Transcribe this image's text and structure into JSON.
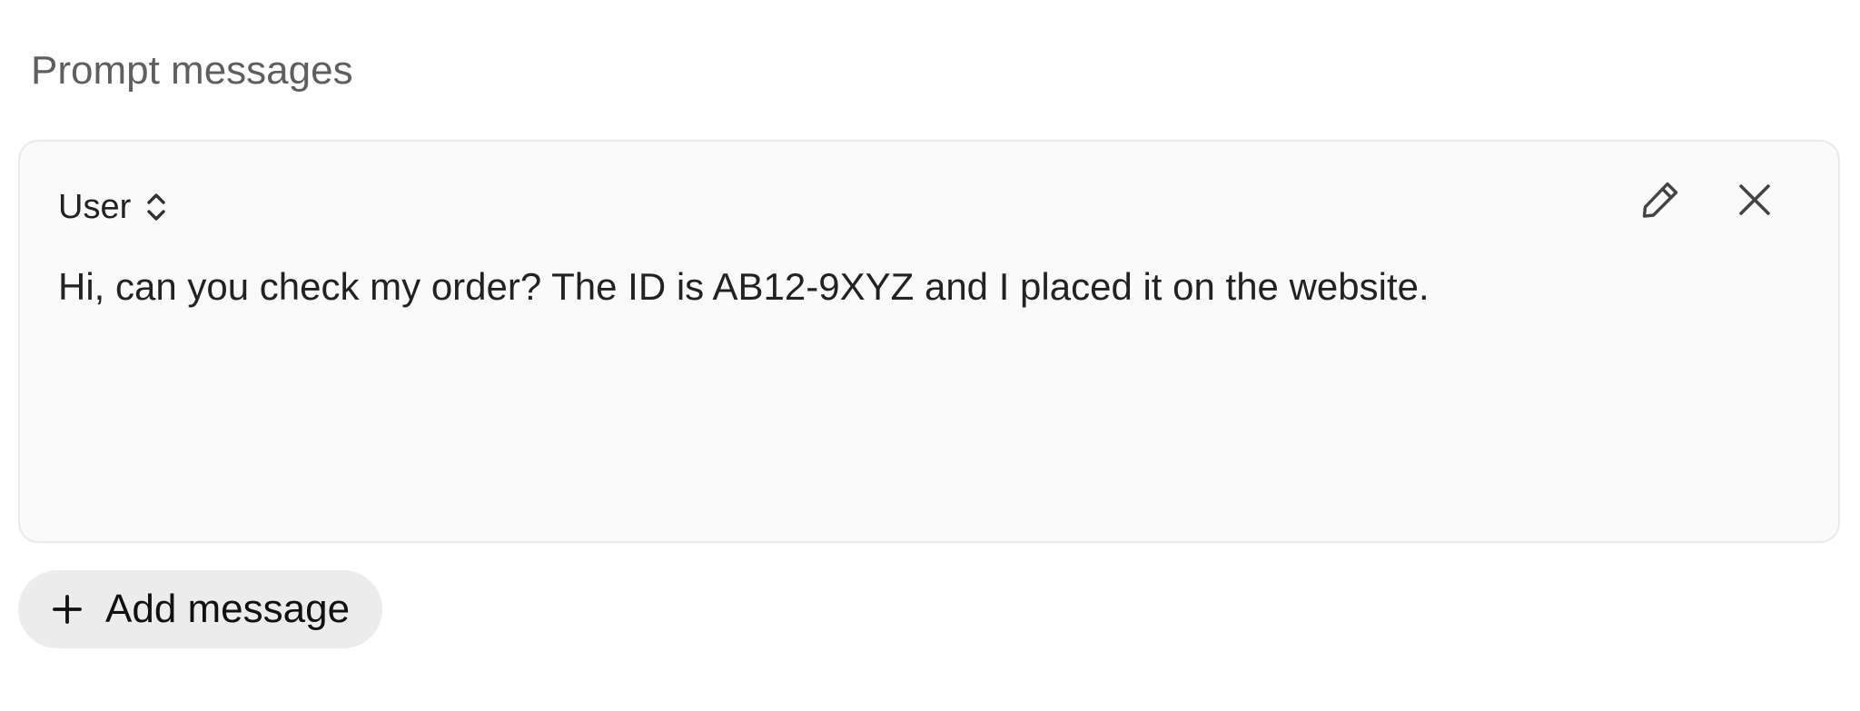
{
  "section": {
    "title": "Prompt messages"
  },
  "message": {
    "role": "User",
    "text": "Hi, can you check my order? The ID is AB12-9XYZ and I placed it on the website.",
    "icons": {
      "role_toggle": "chevron-up-down-icon",
      "edit": "pencil-icon",
      "remove": "close-icon"
    }
  },
  "actions": {
    "add_message_label": "Add message",
    "add_icon": "plus-icon"
  },
  "colors": {
    "card_background": "#fafafa",
    "card_border": "#e9e9e9",
    "button_background": "#ececec",
    "muted_text": "#5f5f5f",
    "text": "#222222"
  }
}
